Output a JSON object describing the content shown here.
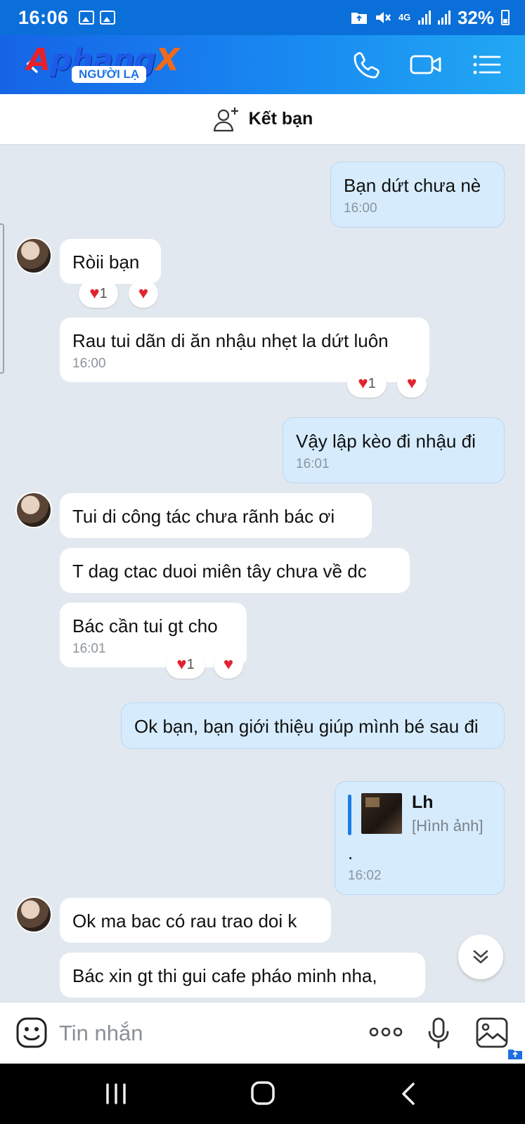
{
  "status_bar": {
    "time": "16:06",
    "network": "4G",
    "battery": "32%"
  },
  "header": {
    "logo": {
      "part1": "A",
      "part2": "phang",
      "part3": "X"
    },
    "badge": "NGƯỜI LẠ"
  },
  "friend_bar": {
    "label": "Kết bạn"
  },
  "messages": [
    {
      "dir": "out",
      "text": "Bạn dứt chưa nè",
      "time": "16:00"
    },
    {
      "dir": "in",
      "text": "Ròii bạn",
      "reaction_count": "1"
    },
    {
      "dir": "in",
      "text": "Rau tui dãn di ăn nhậu nhẹt la dứt luôn",
      "time": "16:00",
      "reaction_count": "1"
    },
    {
      "dir": "out",
      "text": "Vậy lập kèo đi nhậu đi",
      "time": "16:01"
    },
    {
      "dir": "in",
      "text": "Tui di công tác chưa rãnh bác ơi"
    },
    {
      "dir": "in",
      "text": "T dag ctac duoi miên tây chưa về dc"
    },
    {
      "dir": "in",
      "text": "Bác cần tui gt cho",
      "time": "16:01",
      "reaction_count": "1"
    },
    {
      "dir": "out",
      "text": "Ok bạn, bạn giới thiệu giúp mình bé sau đi"
    },
    {
      "dir": "out",
      "reply_name": "Lh",
      "reply_type": "[Hình ảnh]",
      "text": ".",
      "time": "16:02"
    },
    {
      "dir": "in",
      "text": "Ok ma bac có rau trao doi k"
    },
    {
      "dir": "in",
      "text": "Bác xin gt thi gui cafe pháo minh nha,"
    }
  ],
  "input": {
    "placeholder": "Tin nhắn"
  },
  "colors": {
    "header_blue": "#1a7eef",
    "out_bubble": "#d6ecfd",
    "in_bubble": "#ffffff",
    "heart": "#e0242f"
  }
}
